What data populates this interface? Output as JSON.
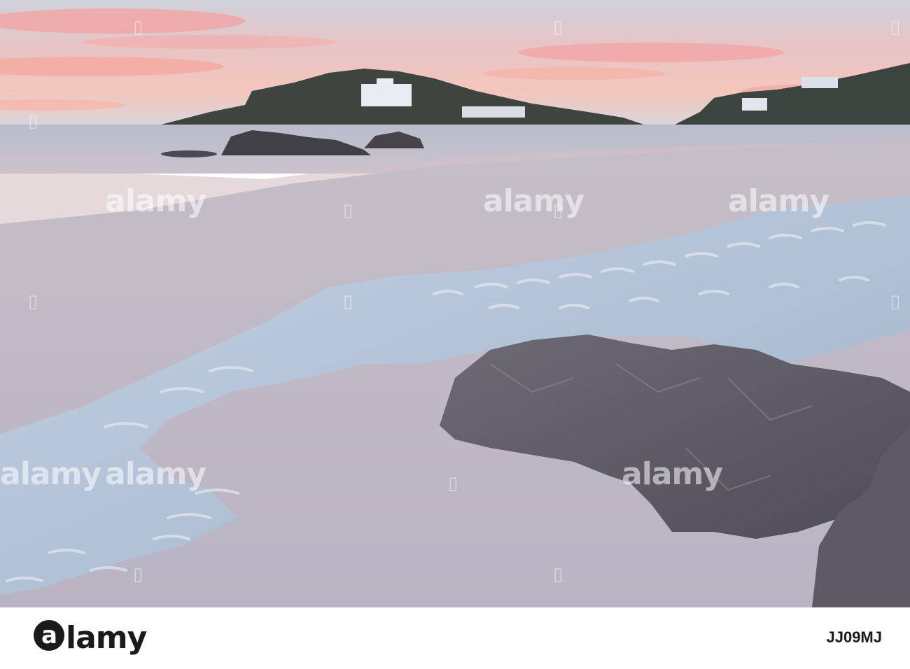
{
  "photo": {
    "subject": "beach-at-dusk",
    "colors": {
      "sky_top": "#c8ccd6",
      "sky_pink": "#f0a0a0",
      "sea": "#b8bcca",
      "sand": "#c2bcc6",
      "wet_sand": "#a9b4c8",
      "rock": "#5e5b67",
      "island": "#3f463f"
    }
  },
  "watermark": {
    "text": "alamy"
  },
  "footer": {
    "logo_text": "alamy",
    "image_id": "JJ09MJ"
  }
}
